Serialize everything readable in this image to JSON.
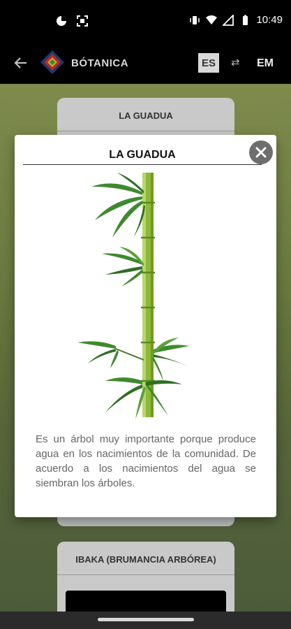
{
  "status_bar": {
    "time": "10:49",
    "icons": [
      "pie-chart-icon",
      "screenshot-icon",
      "vibrate-icon",
      "wifi-icon",
      "signal-icon",
      "battery-icon"
    ]
  },
  "app_bar": {
    "title": "BÓTANICA",
    "lang_active": "ES",
    "lang_other": "EM",
    "swap_symbol": "⇄"
  },
  "background": {
    "card1_title": "LA GUADUA",
    "card2_title": "IBAKA (BRUMANCIA ARBÓREA)"
  },
  "modal": {
    "title": "LA GUADUA",
    "description": "Es un árbol muy importante porque produce agua en los nacimientos de la comunidad. De acuerdo a los nacimientos del agua se siembran los árboles.",
    "image": "bamboo-illustration"
  },
  "colors": {
    "app_bar": "#000000",
    "accent_green": "#8db83a",
    "close_button": "#6e6e6e",
    "body_text": "#666666"
  }
}
